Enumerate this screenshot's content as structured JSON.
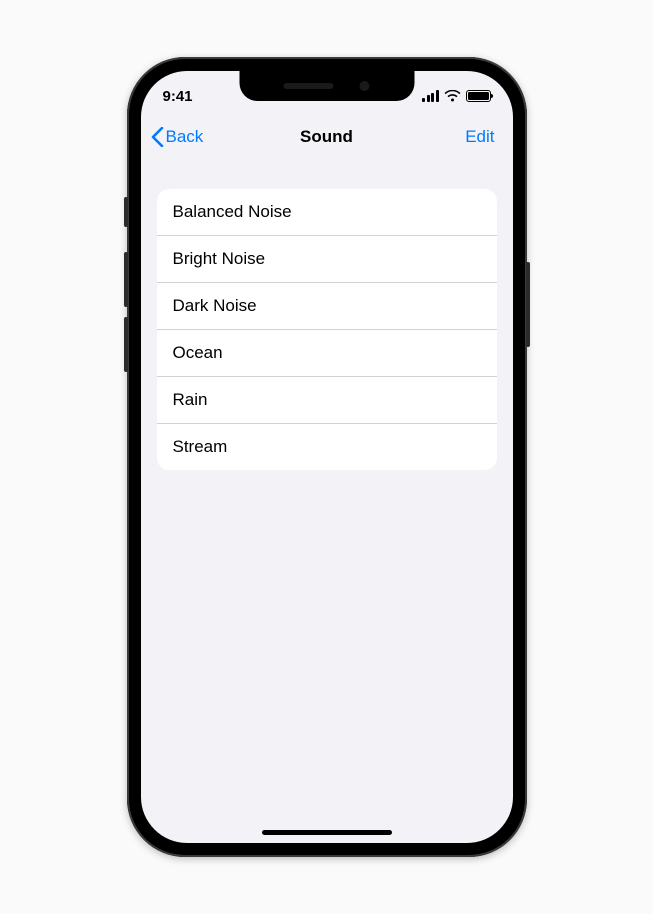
{
  "status": {
    "time": "9:41"
  },
  "nav": {
    "back": "Back",
    "title": "Sound",
    "edit": "Edit"
  },
  "sounds": [
    "Balanced Noise",
    "Bright Noise",
    "Dark Noise",
    "Ocean",
    "Rain",
    "Stream"
  ]
}
